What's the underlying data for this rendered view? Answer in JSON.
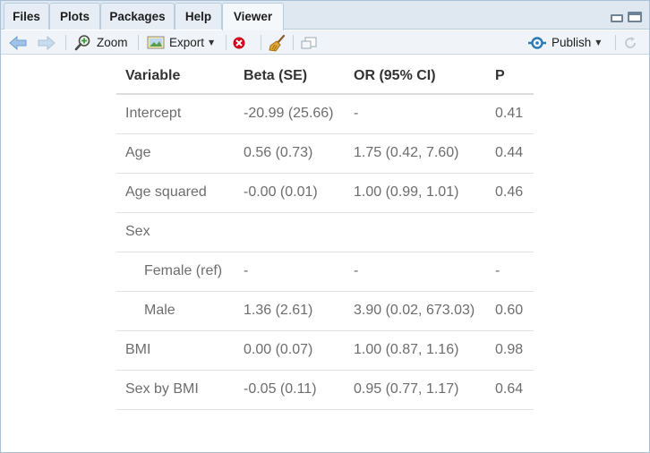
{
  "tabs": [
    {
      "label": "Files",
      "active": false
    },
    {
      "label": "Plots",
      "active": false
    },
    {
      "label": "Packages",
      "active": false
    },
    {
      "label": "Help",
      "active": false
    },
    {
      "label": "Viewer",
      "active": true
    }
  ],
  "toolbar": {
    "zoom_label": "Zoom",
    "export_label": "Export",
    "publish_label": "Publish"
  },
  "icons": {
    "back": "arrow-left-icon",
    "forward": "arrow-right-icon",
    "zoom": "zoom-icon",
    "export": "export-icon",
    "remove": "remove-icon",
    "clear": "broom-icon",
    "popout": "popout-icon",
    "publish": "publish-icon",
    "refresh": "refresh-icon"
  },
  "colors": {
    "tab_bg": "#dfe8f1",
    "toolbar_bg": "#f0f4f8",
    "accent": "#2a7ab8",
    "remove_red": "#d0021b"
  },
  "table": {
    "headers": [
      "Variable",
      "Beta (SE)",
      "OR (95% CI)",
      "P"
    ],
    "rows": [
      {
        "cells": [
          "Intercept",
          "-20.99 (25.66)",
          "-",
          "0.41"
        ],
        "indent": false
      },
      {
        "cells": [
          "Age",
          "0.56 (0.73)",
          "1.75 (0.42, 7.60)",
          "0.44"
        ],
        "indent": false
      },
      {
        "cells": [
          "Age squared",
          "-0.00 (0.01)",
          "1.00 (0.99, 1.01)",
          "0.46"
        ],
        "indent": false
      },
      {
        "cells": [
          "Sex",
          "",
          "",
          ""
        ],
        "indent": false
      },
      {
        "cells": [
          "Female (ref)",
          "-",
          "-",
          "-"
        ],
        "indent": true
      },
      {
        "cells": [
          "Male",
          "1.36 (2.61)",
          "3.90 (0.02, 673.03)",
          "0.60"
        ],
        "indent": true
      },
      {
        "cells": [
          "BMI",
          "0.00 (0.07)",
          "1.00 (0.87, 1.16)",
          "0.98"
        ],
        "indent": false
      },
      {
        "cells": [
          "Sex by BMI",
          "-0.05 (0.11)",
          "0.95 (0.77, 1.17)",
          "0.64"
        ],
        "indent": false
      }
    ]
  }
}
